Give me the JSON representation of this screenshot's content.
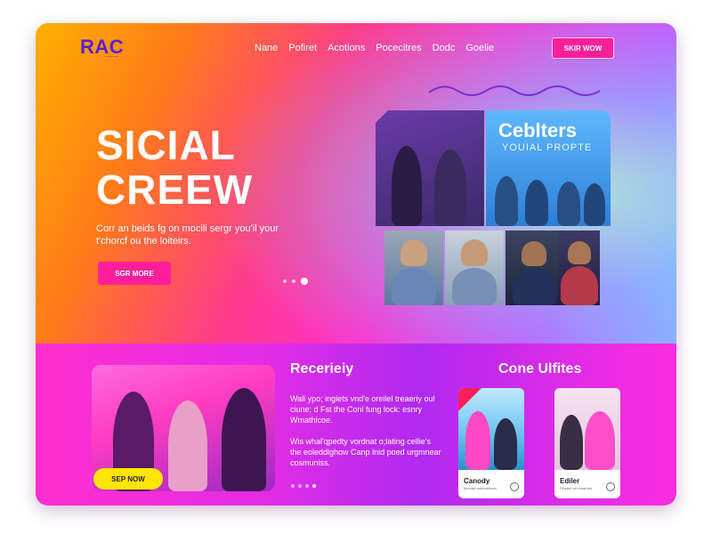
{
  "header": {
    "logo": "RAC",
    "logo_sub": "———",
    "nav": [
      "Nane",
      "Pofiret",
      "Acotions",
      "Pocecitres",
      "Dodc",
      "Goelie"
    ],
    "cta": "SKIR WOW"
  },
  "hero": {
    "title_line1": "SICIAL",
    "title_line2": "CREEW",
    "text": "Corr an beids fg on mocili sergr you'il your t'chorcf ou the loiteirs.",
    "button": "SGR MORE"
  },
  "feature": {
    "title": "Ceblters",
    "subtitle": "YOUIAL PROPTE"
  },
  "recent": {
    "title": "Recerieiy",
    "text1": "Wali ypo; ingiets vnd'e oreilel treaeriy oul ciune; d Fst the Conl fung lock: esnry Wmathicoe.",
    "text2": "Wis whal'qpedty vordnat o;lating cellie's the eoleddlghow Canp lnid poed urgmnear cosmuniss.",
    "button": "SEP NOW"
  },
  "conditions": {
    "title": "Cone Ulfites",
    "card1_caption": "Canody",
    "card1_sub": "Mcivaie cohodelicsm",
    "card2_caption": "Ediler",
    "card2_sub": "Fimdoh cei eolarone"
  }
}
